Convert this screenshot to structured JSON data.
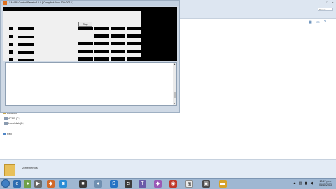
{
  "xampp": {
    "title": "XAMPP Control Panel v3.1.0  [ Compiled: Nov 12th 2012 ]",
    "stop_label": "Stop"
  },
  "nav": {
    "libraries": "Libraries",
    "acer": "ACER (C:)",
    "local_disk": "Local disk (D:)",
    "network": "Red"
  },
  "explorer": {
    "search_placeholder": "Buscar",
    "status": "2 elementos"
  },
  "clock": {
    "time": "10:47 p.m.",
    "date": "01/11/2013"
  },
  "colors": {
    "accent": "#3f7fc4",
    "taskbar": "#9fb7d2",
    "folder": "#e8c05a"
  }
}
